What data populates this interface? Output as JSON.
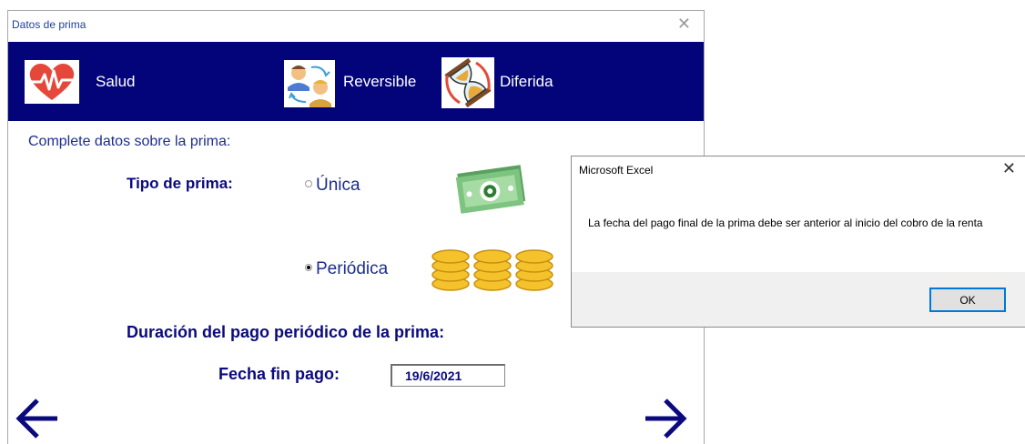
{
  "window": {
    "title": "Datos de prima",
    "close_glyph": "✕"
  },
  "tabs": [
    {
      "label": "Salud",
      "icon": "heart-pulse-icon"
    },
    {
      "label": "Reversible",
      "icon": "people-exchange-icon"
    },
    {
      "label": "Diferida",
      "icon": "hourglass-icon"
    }
  ],
  "form": {
    "prompt": "Complete datos sobre la prima:",
    "tipo_label": "Tipo de prima:",
    "options": [
      {
        "label": "Única",
        "selected": false,
        "icon": "banknote-icon"
      },
      {
        "label": "Periódica",
        "selected": true,
        "icon": "coin-stacks-icon"
      }
    ],
    "duracion_label": "Duración del pago periódico de la prima:",
    "fecha_label": "Fecha fin pago:",
    "fecha_value": "19/6/2021"
  },
  "nav": {
    "back_icon": "arrow-left-icon",
    "next_icon": "arrow-right-icon"
  },
  "dialog": {
    "title": "Microsoft Excel",
    "close_glyph": "✕",
    "message": "La fecha del pago final de la prima debe ser anterior al inicio del cobro de la renta",
    "ok_label": "OK"
  },
  "colors": {
    "banner": "#04047a",
    "text_blue": "#1d2e8e",
    "bold_blue": "#0a0a7e"
  }
}
